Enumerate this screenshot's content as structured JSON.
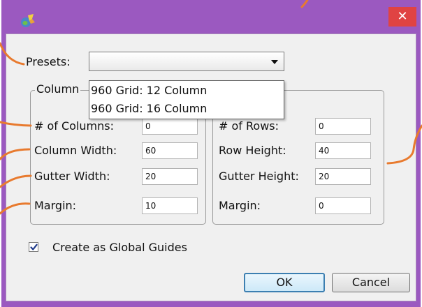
{
  "window": {
    "title_icon": "app-icon",
    "close_label": "✕",
    "frame_color": "#9b59c0",
    "close_color": "#e04343"
  },
  "presets": {
    "label": "Presets:",
    "selected_value": "",
    "options": [
      "960 Grid: 12 Column",
      "960 Grid: 16 Column"
    ]
  },
  "columns": {
    "group_title": "Column",
    "fields": [
      {
        "label": "# of Columns:",
        "value": "0"
      },
      {
        "label": "Column Width:",
        "value": "60"
      },
      {
        "label": "Gutter Width:",
        "value": "20"
      },
      {
        "label": "Margin:",
        "value": "10"
      }
    ]
  },
  "rows": {
    "fields": [
      {
        "label": "# of Rows:",
        "value": "0"
      },
      {
        "label": "Row Height:",
        "value": "40"
      },
      {
        "label": "Gutter Height:",
        "value": "20"
      },
      {
        "label": "Margin:",
        "value": "0"
      }
    ]
  },
  "global_guides": {
    "label": "Create as Global Guides",
    "checked": true
  },
  "buttons": {
    "ok_label": "OK",
    "cancel_label": "Cancel"
  },
  "callouts": {
    "color": "#e87a2e"
  }
}
